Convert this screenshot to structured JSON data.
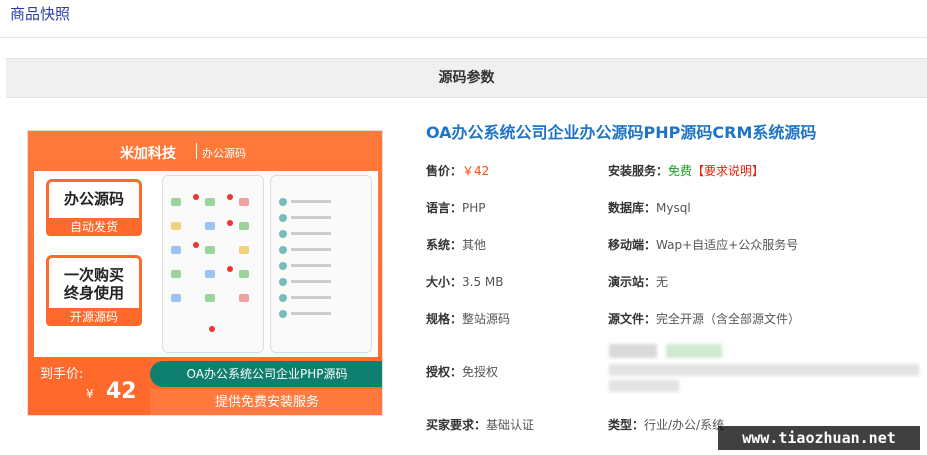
{
  "tabs": {
    "snapshot": "商品快照"
  },
  "section": {
    "header": "源码参数"
  },
  "image": {
    "brand": "米加科技",
    "brand_sub": "办公源码",
    "badge1_main": "办公源码",
    "badge1_tag": "自动发货",
    "badge2_main_line1": "一次购买",
    "badge2_main_line2": "终身使用",
    "badge2_tag": "开源源码",
    "price_label": "到手价:",
    "price_yen": "¥",
    "price_value": "42",
    "title_band": "OA办公系统公司企业PHP源码",
    "install_band": "提供免费安装服务"
  },
  "product": {
    "title": "OA办公系统公司企业办公源码PHP源码CRM系统源码",
    "fields": {
      "price_k": "售价：",
      "price_v": "￥42",
      "install_k": "安装服务：",
      "install_free": "免费",
      "install_req": "【要求说明】",
      "lang_k": "语言：",
      "lang_v": "PHP",
      "db_k": "数据库：",
      "db_v": "Mysql",
      "sys_k": "系统：",
      "sys_v": "其他",
      "mobile_k": "移动端：",
      "mobile_v": "Wap+自适应+公众服务号",
      "size_k": "大小：",
      "size_v": "3.5 MB",
      "demo_k": "演示站：",
      "demo_v": "无",
      "spec_k": "规格：",
      "spec_v": "整站源码",
      "src_k": "源文件：",
      "src_v": "完全开源（含全部源文件）",
      "auth_k": "授权：",
      "auth_v": "免授权",
      "buy_k": "买家要求：",
      "buy_v": "基础认证",
      "type_k": "类型：",
      "type_v": "行业/办公/系统"
    }
  },
  "watermark": "www.tiaozhuan.net",
  "colors": {
    "accent": "#1f74c6",
    "price": "#ff4a00",
    "free": "#1a9c1a",
    "orange": "#ff6a2c"
  }
}
